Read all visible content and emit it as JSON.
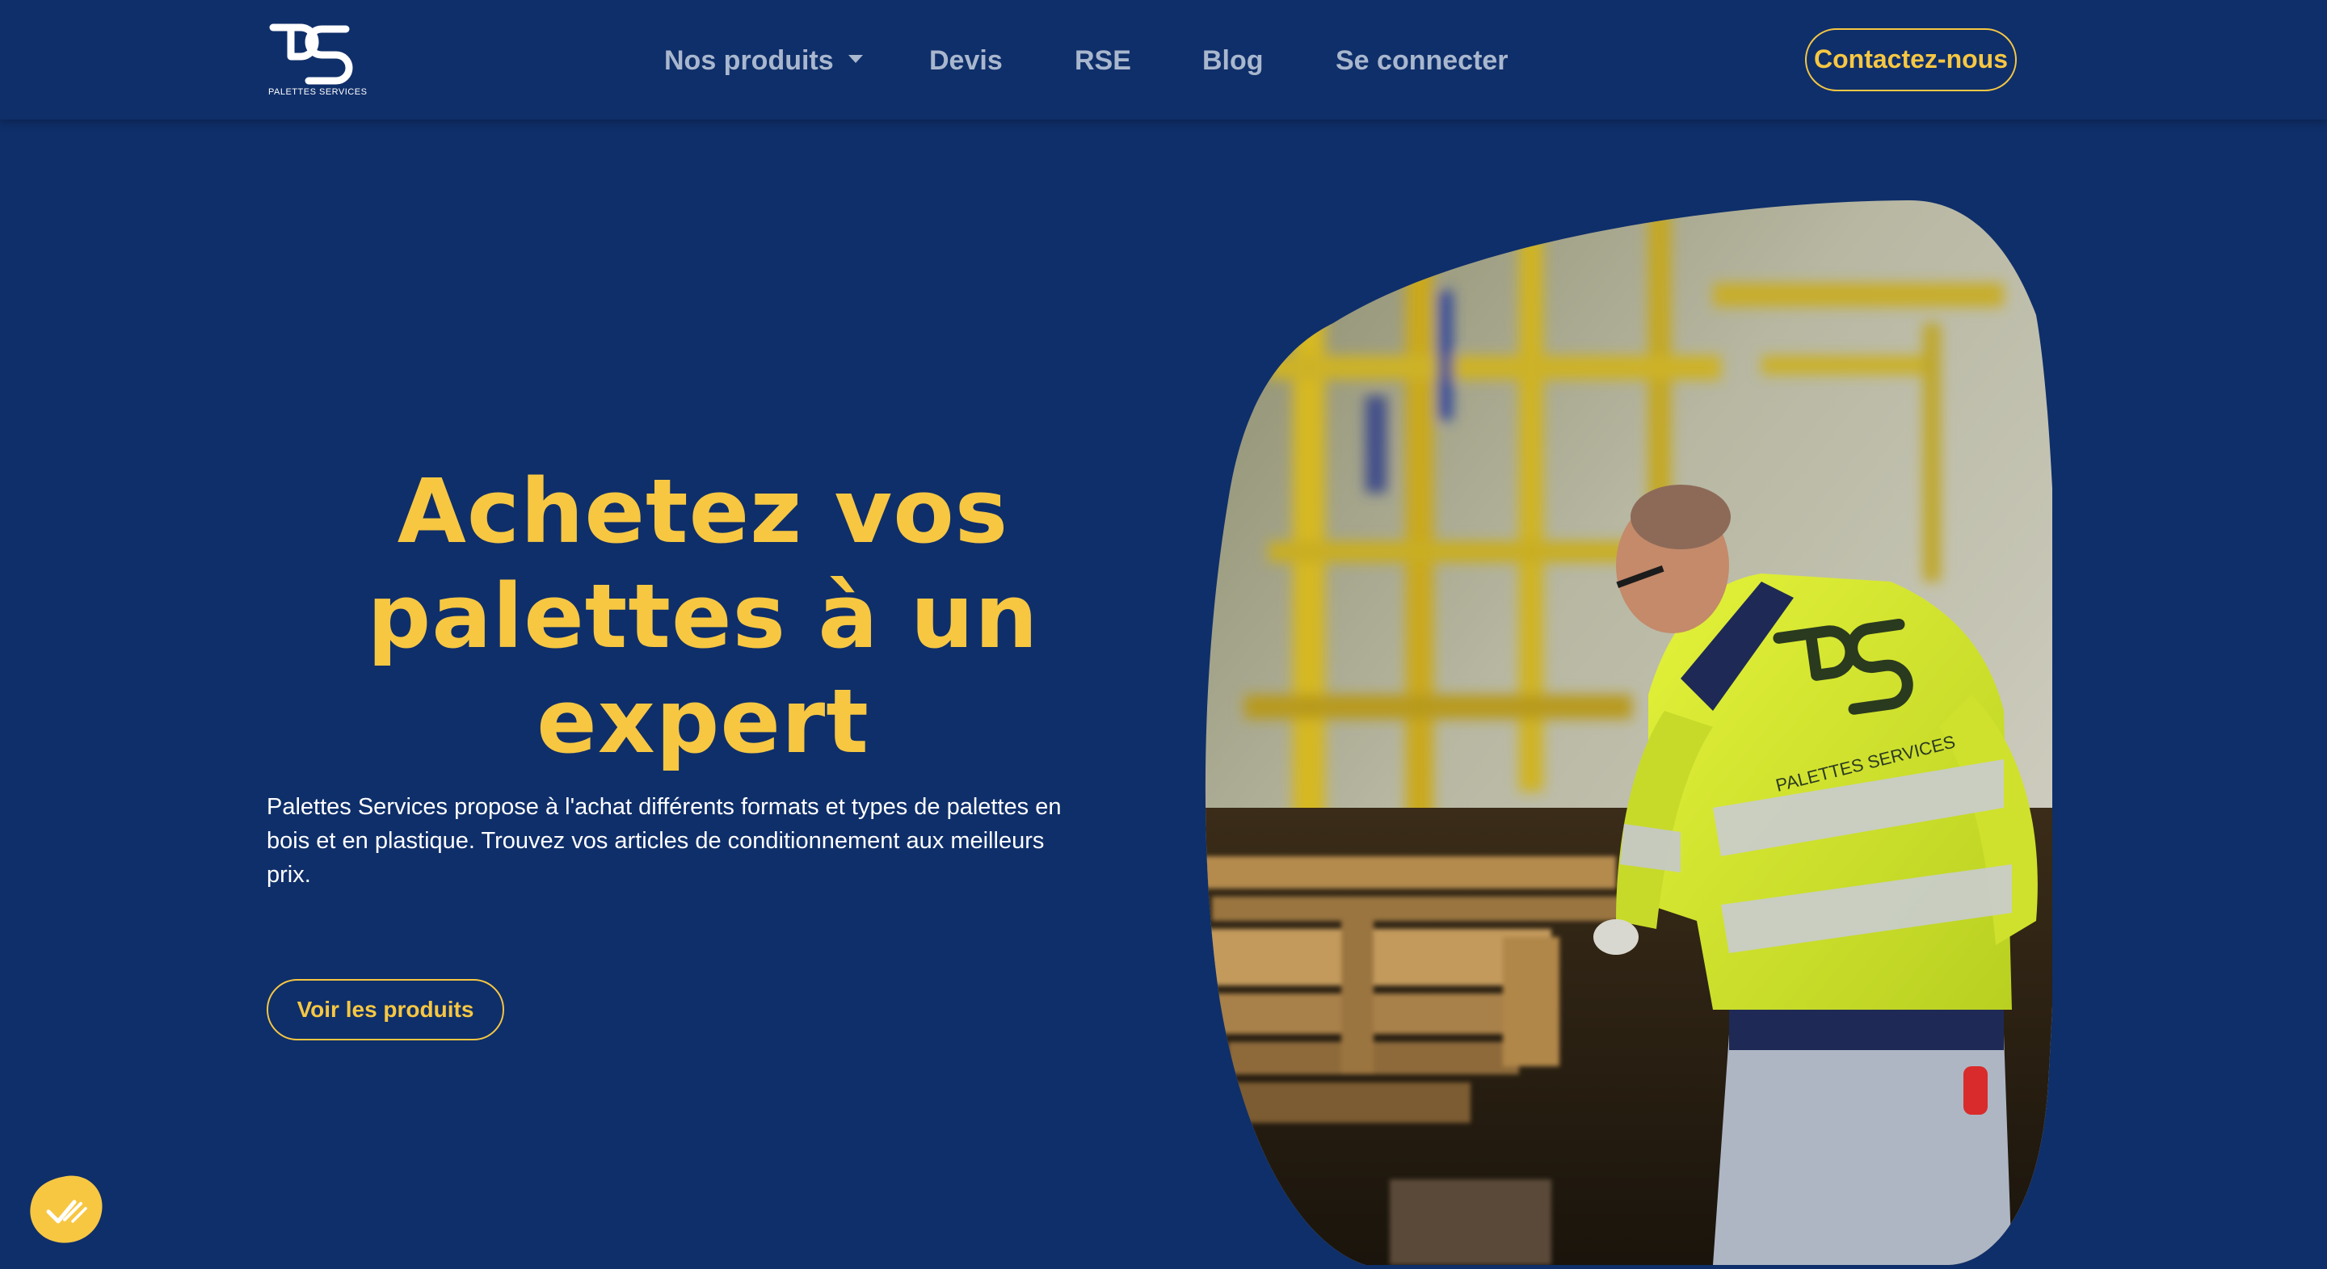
{
  "brand": {
    "logo_text": "PALETTES SERVICES",
    "jacket_logo_text": "PALETTES SERVICES"
  },
  "nav": {
    "items": [
      {
        "label": "Nos produits",
        "has_dropdown": true
      },
      {
        "label": "Devis"
      },
      {
        "label": "RSE"
      },
      {
        "label": "Blog"
      },
      {
        "label": "Se connecter"
      }
    ],
    "contact_label": "Contactez-nous"
  },
  "hero": {
    "title_lines": [
      "Achetez vos",
      "palettes à un",
      "expert"
    ],
    "description": "Palettes Services propose à l'achat différents formats et types de palettes en bois et en plastique. Trouvez vos articles de conditionnement aux meilleurs prix.",
    "description_lines": [
      "Palettes Services propose à l'achat différents formats et types de palettes en",
      "bois et en plastique. Trouvez vos articles de conditionnement aux meilleurs",
      "prix."
    ],
    "cta_label": "Voir les produits",
    "image_icon": "warehouse-worker-photo"
  },
  "cookie": {
    "icon": "cookie-consent-icon"
  },
  "colors": {
    "background": "#0f2f6a",
    "accent": "#f7c742",
    "nav_text": "#a9b7ce",
    "text": "#ffffff"
  }
}
